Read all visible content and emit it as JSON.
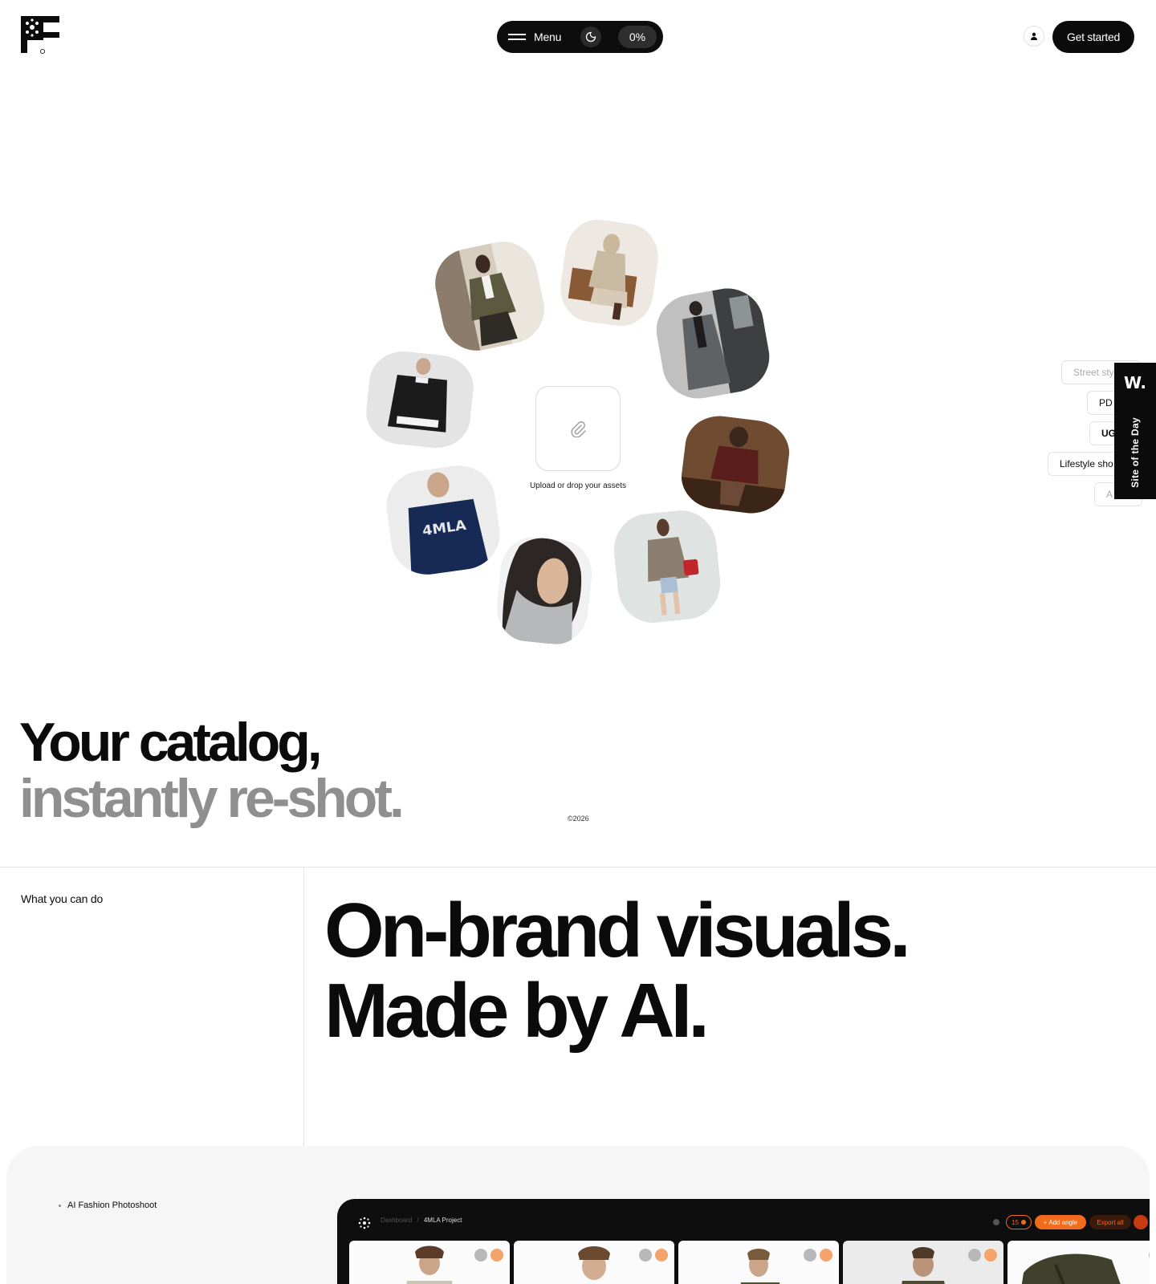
{
  "header": {
    "menu_label": "Menu",
    "theme_icon": "moon-icon",
    "progress": "0%",
    "user_icon": "user-icon",
    "cta_label": "Get started"
  },
  "hero": {
    "upload_label": "Upload or drop your assets",
    "upload_icon": "paperclip-icon",
    "title_line1": "Your catalog,",
    "title_line2": "instantly re-shot.",
    "copyright": "©2026"
  },
  "side_tags": [
    "Street sty",
    "PD",
    "UG",
    "Lifestyle sho",
    "A"
  ],
  "award": {
    "mark": "W.",
    "label": "Site of the Day"
  },
  "section": {
    "label": "What you can do",
    "title_line1": "On-brand visuals.",
    "title_line2": "Made by AI."
  },
  "showcase": {
    "label": "AI Fashion Photoshoot",
    "app": {
      "crumb_root": "Dashboard",
      "crumb_sep": "/",
      "crumb_project": "4MLA Project",
      "credits": "15",
      "add_angle": "+ Add angle",
      "export_all": "Export all"
    }
  },
  "colors": {
    "ink": "#0b0b0b",
    "muted_title": "#8f8f8f",
    "accent_orange": "#f26a1b",
    "panel": "#f6f6f6"
  }
}
